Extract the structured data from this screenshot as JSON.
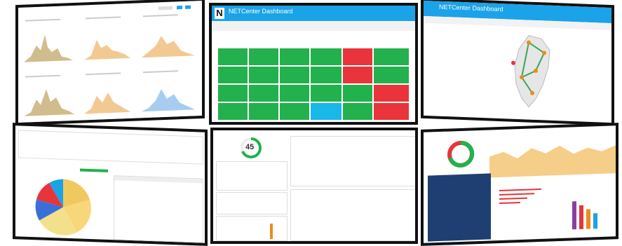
{
  "tiles": {
    "dash2": {
      "title": "NETCenter Dashboard",
      "logo": "N"
    },
    "dash3": {
      "title": "NETCenter Dashboard"
    },
    "dash5": {
      "gauge_value": "45"
    }
  },
  "colors": {
    "frame": "#111111",
    "header": "#1aa3e8",
    "ok": "#22b14c",
    "alert": "#e8343a",
    "empty": "#18b8e8"
  }
}
